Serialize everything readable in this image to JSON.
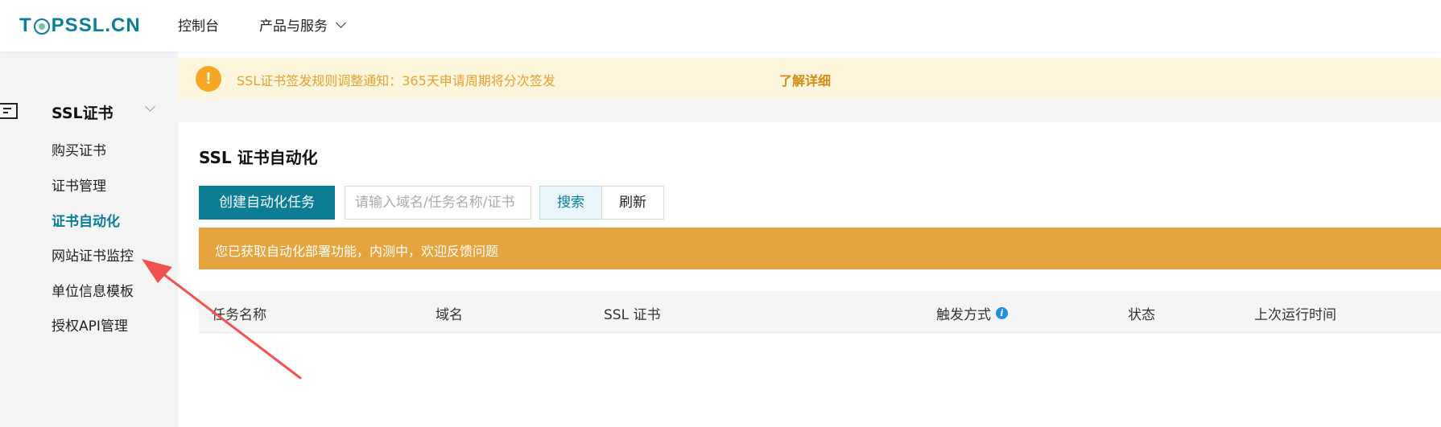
{
  "header": {
    "logo_prefix": "T",
    "logo_suffix": "PSSL.CN",
    "nav": {
      "console": "控制台",
      "products": "产品与服务"
    }
  },
  "sidebar": {
    "group_label": "SSL证书",
    "items": [
      {
        "label": "购买证书"
      },
      {
        "label": "证书管理"
      },
      {
        "label": "证书自动化"
      },
      {
        "label": "网站证书监控"
      },
      {
        "label": "单位信息模板"
      },
      {
        "label": "授权API管理"
      }
    ],
    "active_index": 2
  },
  "notice": {
    "icon": "!",
    "text": "SSL证书签发规则调整通知：365天申请周期将分次签发",
    "link": "了解详细"
  },
  "main": {
    "title": "SSL 证书自动化",
    "create_button": "创建自动化任务",
    "search_placeholder": "请输入域名/任务名称/证书",
    "search_button": "搜索",
    "refresh_button": "刷新",
    "beta_banner": "您已获取自动化部署功能，内测中，欢迎反馈问题",
    "table": {
      "columns": [
        "任务名称",
        "域名",
        "SSL 证书",
        "触发方式",
        "状态",
        "上次运行时间"
      ]
    }
  },
  "colors": {
    "brand": "#0b7e96",
    "notice_bg": "#fdf6dc",
    "notice_text": "#e0a233",
    "beta_banner": "#e4a33e",
    "annotation_arrow": "#ef5350"
  }
}
